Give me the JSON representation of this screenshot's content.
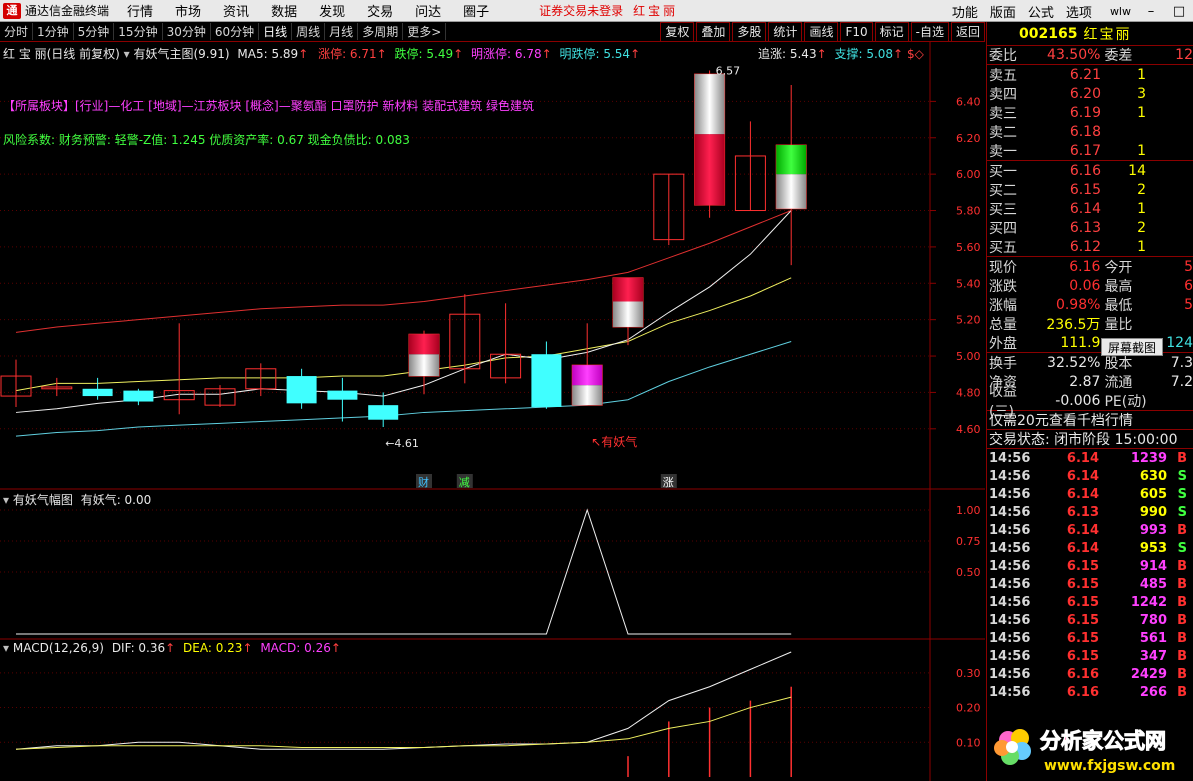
{
  "app": {
    "title": "通达信金融终端",
    "menus": [
      "行情",
      "市场",
      "资讯",
      "数据",
      "发现",
      "交易",
      "问达",
      "圈子"
    ],
    "notice": "证券交易未登录",
    "stock_name": "红宝丽",
    "right_menus": [
      "功能",
      "版面",
      "公式",
      "选项"
    ],
    "wl": "wlw"
  },
  "toolbar": {
    "periods": [
      "分时",
      "1分钟",
      "5分钟",
      "15分钟",
      "30分钟",
      "60分钟",
      "日线",
      "周线",
      "月线",
      "多周期",
      "更多>"
    ],
    "active_period": "日线",
    "tools": [
      "复权",
      "叠加",
      "多股",
      "统计",
      "画线",
      "F10",
      "标记",
      "-自选",
      "返回"
    ]
  },
  "main_chart": {
    "title": "红 宝 丽(日线 前复权)",
    "indicator": "有妖气主图(9.91)",
    "ma5": "MA5: 5.89",
    "zhangting": "涨停: 6.71",
    "dieting": "跌停: 5.49",
    "ming_zhangting": "明涨停: 6.78",
    "ming_dieting": "明跌停: 5.54",
    "zhuizhang": "追涨: 5.43",
    "zhicheng": "支撑: 5.08",
    "sector_info": "【所属板块】[行业]—化工 [地域]—江苏板块 [概念]—聚氨酯 口罩防护 新材料 装配式建筑 绿色建筑",
    "risk_info": "风险系数: 财务预警: 轻警-Z值: 1.245 优质资产率: 0.67 现金负债比: 0.083",
    "high_label": "6.57",
    "low_label": "4.61",
    "signal_label": "有妖气",
    "markers": [
      "财",
      "减",
      "涨"
    ],
    "yticks": [
      "6.40",
      "6.20",
      "6.00",
      "5.80",
      "5.60",
      "5.40",
      "5.20",
      "5.00",
      "4.80",
      "4.60"
    ]
  },
  "sub1": {
    "title": "有妖气幅图",
    "value": "有妖气: 0.00",
    "yticks": [
      "1.00",
      "0.75",
      "0.50"
    ]
  },
  "sub2": {
    "title": "MACD(12,26,9)",
    "dif": "DIF: 0.36",
    "dea": "DEA: 0.23",
    "macd": "MACD: 0.26",
    "yticks": [
      "0.30",
      "0.20",
      "0.10"
    ]
  },
  "chart_data": {
    "type": "candlestick",
    "y_range": [
      4.5,
      6.6
    ],
    "candles": [
      {
        "o": 4.78,
        "h": 4.98,
        "l": 4.72,
        "c": 4.89,
        "up": false
      },
      {
        "o": 4.82,
        "h": 4.88,
        "l": 4.78,
        "c": 4.83,
        "up": false
      },
      {
        "o": 4.82,
        "h": 4.88,
        "l": 4.76,
        "c": 4.78,
        "up": false
      },
      {
        "o": 4.81,
        "h": 4.82,
        "l": 4.73,
        "c": 4.75,
        "up": false
      },
      {
        "o": 4.76,
        "h": 5.18,
        "l": 4.68,
        "c": 4.81,
        "up": true
      },
      {
        "o": 4.73,
        "h": 4.84,
        "l": 4.72,
        "c": 4.82,
        "up": true
      },
      {
        "o": 4.82,
        "h": 4.96,
        "l": 4.78,
        "c": 4.93,
        "up": true
      },
      {
        "o": 4.89,
        "h": 4.93,
        "l": 4.71,
        "c": 4.74,
        "up": false
      },
      {
        "o": 4.81,
        "h": 4.88,
        "l": 4.64,
        "c": 4.76,
        "up": false
      },
      {
        "o": 4.73,
        "h": 4.8,
        "l": 4.61,
        "c": 4.65,
        "up": false
      },
      {
        "o": 4.89,
        "h": 5.14,
        "l": 4.79,
        "c": 5.12,
        "up": true
      },
      {
        "o": 4.93,
        "h": 5.34,
        "l": 4.85,
        "c": 5.23,
        "up": false
      },
      {
        "o": 4.88,
        "h": 5.29,
        "l": 4.85,
        "c": 5.01,
        "up": true
      },
      {
        "o": 5.01,
        "h": 5.08,
        "l": 4.71,
        "c": 4.72,
        "up": false
      },
      {
        "o": 4.73,
        "h": 5.18,
        "l": 4.73,
        "c": 4.95,
        "up": true
      },
      {
        "o": 5.16,
        "h": 5.43,
        "l": 5.06,
        "c": 5.43,
        "up": true
      },
      {
        "o": 5.64,
        "h": 6.0,
        "l": 5.61,
        "c": 6.0,
        "up": true
      },
      {
        "o": 5.83,
        "h": 6.57,
        "l": 5.76,
        "c": 6.55,
        "up": true
      },
      {
        "o": 5.8,
        "h": 6.29,
        "l": 5.8,
        "c": 6.1,
        "up": true
      },
      {
        "o": 5.81,
        "h": 6.49,
        "l": 5.5,
        "c": 6.16,
        "up": true
      }
    ],
    "ma_white": [
      4.69,
      4.71,
      4.74,
      4.76,
      4.79,
      4.79,
      4.82,
      4.81,
      4.8,
      4.78,
      4.84,
      4.93,
      5.01,
      4.98,
      5.02,
      5.09,
      5.24,
      5.38,
      5.56,
      5.8
    ],
    "ma_yellow": [
      4.81,
      4.85,
      4.85,
      4.86,
      4.87,
      4.88,
      4.88,
      4.88,
      4.89,
      4.89,
      4.92,
      4.95,
      4.99,
      5.0,
      5.04,
      5.08,
      5.18,
      5.25,
      5.33,
      5.43
    ],
    "ma_red": [
      5.13,
      5.16,
      5.18,
      5.2,
      5.22,
      5.24,
      5.26,
      5.27,
      5.28,
      5.28,
      5.3,
      5.33,
      5.36,
      5.39,
      5.42,
      5.46,
      5.54,
      5.62,
      5.71,
      5.8
    ],
    "ma_cyan": [
      4.56,
      4.58,
      4.59,
      4.61,
      4.62,
      4.63,
      4.64,
      4.65,
      4.66,
      4.67,
      4.69,
      4.7,
      4.71,
      4.72,
      4.73,
      4.76,
      4.86,
      4.94,
      5.01,
      5.08
    ],
    "sub1_line": [
      0,
      0,
      0,
      0,
      0,
      0,
      0,
      0,
      0,
      0,
      0,
      0,
      0,
      0,
      1.0,
      0,
      0,
      0,
      0,
      0
    ],
    "sub1_y_range": [
      0,
      1.0
    ],
    "macd_dif": [
      0.08,
      0.09,
      0.09,
      0.1,
      0.1,
      0.09,
      0.08,
      0.08,
      0.08,
      0.08,
      0.085,
      0.09,
      0.095,
      0.095,
      0.1,
      0.14,
      0.22,
      0.26,
      0.31,
      0.36
    ],
    "macd_dea": [
      0.08,
      0.085,
      0.09,
      0.09,
      0.09,
      0.09,
      0.09,
      0.085,
      0.085,
      0.085,
      0.085,
      0.09,
      0.09,
      0.095,
      0.1,
      0.11,
      0.14,
      0.16,
      0.2,
      0.23
    ],
    "macd_bars": [
      0,
      0,
      0,
      0,
      0,
      0,
      0,
      0,
      0,
      0,
      0,
      0,
      0,
      0,
      0,
      0.06,
      0.16,
      0.2,
      0.22,
      0.26
    ],
    "macd_y_range": [
      0.0,
      0.36
    ]
  },
  "quote": {
    "code": "002165",
    "name": "红宝丽",
    "weibi_label": "委比",
    "weibi": "43.50%",
    "weicha_label": "委差",
    "weicha": "12",
    "asks": [
      {
        "label": "卖五",
        "price": "6.21",
        "vol": "1"
      },
      {
        "label": "卖四",
        "price": "6.20",
        "vol": "3"
      },
      {
        "label": "卖三",
        "price": "6.19",
        "vol": "1"
      },
      {
        "label": "卖二",
        "price": "6.18",
        "vol": ""
      },
      {
        "label": "卖一",
        "price": "6.17",
        "vol": "1"
      }
    ],
    "bids": [
      {
        "label": "买一",
        "price": "6.16",
        "vol": "14"
      },
      {
        "label": "买二",
        "price": "6.15",
        "vol": "2"
      },
      {
        "label": "买三",
        "price": "6.14",
        "vol": "1"
      },
      {
        "label": "买四",
        "price": "6.13",
        "vol": "2"
      },
      {
        "label": "买五",
        "price": "6.12",
        "vol": "1"
      }
    ],
    "stats": [
      {
        "l": "现价",
        "v": "6.16",
        "l2": "今开",
        "v2": "5"
      },
      {
        "l": "涨跌",
        "v": "0.06",
        "l2": "最高",
        "v2": "6"
      },
      {
        "l": "涨幅",
        "v": "0.98%",
        "l2": "最低",
        "v2": "5"
      },
      {
        "l": "总量",
        "v": "236.5万",
        "l2": "量比",
        "v2": ""
      },
      {
        "l": "外盘",
        "v": "111.9",
        "l2": "",
        "v2": "124"
      }
    ],
    "stats2": [
      {
        "l": "换手",
        "v": "32.52%",
        "l2": "股本",
        "v2": "7.3"
      },
      {
        "l": "净资",
        "v": "2.87",
        "l2": "流通",
        "v2": "7.2"
      },
      {
        "l": "收益(三)",
        "v": "-0.006",
        "l2": "PE(动)",
        "v2": ""
      }
    ],
    "promo": "仅需20元查看千档行情",
    "trade_status": "交易状态: 闭市阶段 15:00:00",
    "screenshot_btn": "屏幕截图",
    "ticks": [
      {
        "t": "14:56",
        "p": "6.14",
        "v": "1239",
        "bs": "B"
      },
      {
        "t": "14:56",
        "p": "6.14",
        "v": "630",
        "bs": "S"
      },
      {
        "t": "14:56",
        "p": "6.14",
        "v": "605",
        "bs": "S"
      },
      {
        "t": "14:56",
        "p": "6.13",
        "v": "990",
        "bs": "S"
      },
      {
        "t": "14:56",
        "p": "6.14",
        "v": "993",
        "bs": "B"
      },
      {
        "t": "14:56",
        "p": "6.14",
        "v": "953",
        "bs": "S"
      },
      {
        "t": "14:56",
        "p": "6.15",
        "v": "914",
        "bs": "B"
      },
      {
        "t": "14:56",
        "p": "6.15",
        "v": "485",
        "bs": "B"
      },
      {
        "t": "14:56",
        "p": "6.15",
        "v": "1242",
        "bs": "B"
      },
      {
        "t": "14:56",
        "p": "6.15",
        "v": "780",
        "bs": "B"
      },
      {
        "t": "14:56",
        "p": "6.15",
        "v": "561",
        "bs": "B"
      },
      {
        "t": "14:56",
        "p": "6.15",
        "v": "347",
        "bs": "B"
      },
      {
        "t": "14:56",
        "p": "6.16",
        "v": "2429",
        "bs": "B"
      },
      {
        "t": "14:56",
        "p": "6.16",
        "v": "266",
        "bs": "B"
      }
    ]
  },
  "watermark": {
    "text": "分析家公式网",
    "url": "www.fxjgsw.com"
  }
}
